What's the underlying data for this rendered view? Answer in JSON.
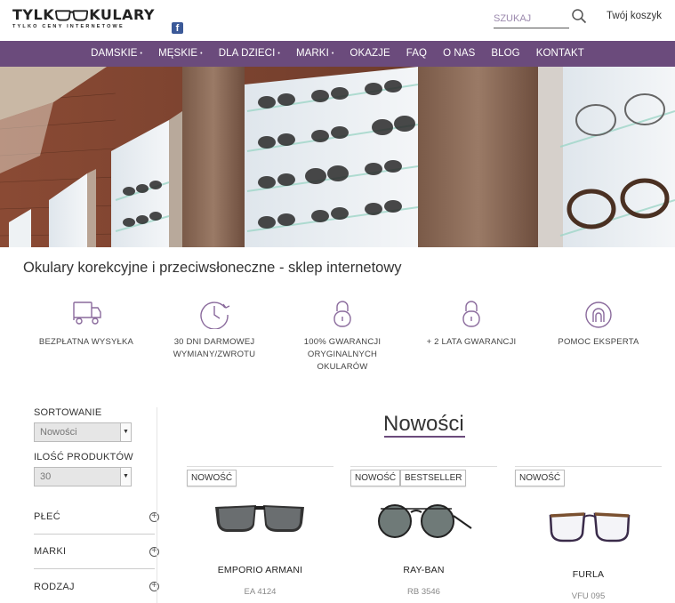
{
  "header": {
    "logo_main": "TYLK        KULARY",
    "logo_left": "TYLK",
    "logo_right": "KULARY",
    "logo_sub": "TYLKO CENY INTERNETOWE",
    "facebook_icon": "f",
    "search_placeholder": "SZUKAJ",
    "cart_label": "Twój koszyk"
  },
  "nav": {
    "items": [
      {
        "label": "DAMSKIE",
        "caret": "•"
      },
      {
        "label": "MĘSKIE",
        "caret": "•"
      },
      {
        "label": "DLA DZIECI",
        "caret": "•"
      },
      {
        "label": "MARKI",
        "caret": "•"
      },
      {
        "label": "OKAZJE"
      },
      {
        "label": "FAQ"
      },
      {
        "label": "O NAS"
      },
      {
        "label": "BLOG"
      },
      {
        "label": "KONTAKT"
      }
    ]
  },
  "page_title": "Okulary korekcyjne i przeciwsłoneczne - sklep internetowy",
  "features": [
    {
      "icon": "delivery-truck-icon",
      "line1": "BEZPŁATNA WYSYŁKA",
      "line2": "",
      "line3": ""
    },
    {
      "icon": "clock-icon",
      "line1": "30 DNI DARMOWEJ",
      "line2": "WYMIANY/ZWROTU",
      "line3": ""
    },
    {
      "icon": "padlock-icon",
      "line1": "100% GWARANCJI",
      "line2": "ORYGINALNYCH",
      "line3": "OKULARÓW"
    },
    {
      "icon": "padlock-icon",
      "line1": "+ 2 LATA GWARANCJI",
      "line2": "",
      "line3": ""
    },
    {
      "icon": "expert-icon",
      "line1": "POMOC EKSPERTA",
      "line2": "",
      "line3": ""
    }
  ],
  "sidebar": {
    "sort_label": "SORTOWANIE",
    "sort_value": "Nowości",
    "count_label": "ILOŚĆ PRODUKTÓW",
    "count_value": "30",
    "filters": [
      "PŁEĆ",
      "MARKI",
      "RODZAJ"
    ],
    "plus_symbol": "+",
    "arrow_symbol": "▼"
  },
  "products_section": {
    "title": "Nowości",
    "products": [
      {
        "badges": [
          "NOWOŚĆ"
        ],
        "name": "EMPORIO ARMANI",
        "model": "EA 4124"
      },
      {
        "badges": [
          "NOWOŚĆ",
          "BESTSELLER"
        ],
        "name": "RAY-BAN",
        "model": "RB 3546"
      },
      {
        "badges": [
          "NOWOŚĆ"
        ],
        "name": "FURLA",
        "model": "VFU 095"
      }
    ]
  },
  "colors": {
    "accent": "#6b4b7c",
    "icon_purple": "#8a6a9c"
  }
}
